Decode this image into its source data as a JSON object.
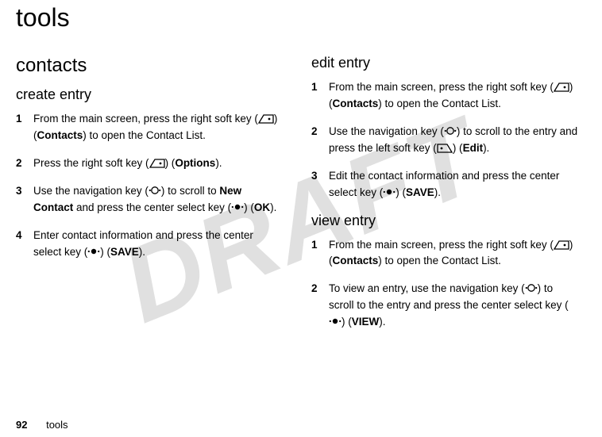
{
  "watermark": "DRAFT",
  "page_title": "tools",
  "left": {
    "section": "contacts",
    "subsection": "create entry",
    "steps": [
      {
        "num": "1",
        "parts": [
          "From the main screen, press the right soft key (",
          {
            "icon": "softkey-right"
          },
          ") (",
          {
            "b": "Contacts"
          },
          ") to open the Contact List."
        ]
      },
      {
        "num": "2",
        "parts": [
          "Press the right soft key (",
          {
            "icon": "softkey-right"
          },
          ") (",
          {
            "b": "Options"
          },
          ")."
        ]
      },
      {
        "num": "3",
        "parts": [
          "Use the navigation key (",
          {
            "icon": "nav"
          },
          ") to scroll to ",
          {
            "b": "New Contact"
          },
          " and press the center select key (",
          {
            "icon": "center"
          },
          ") (",
          {
            "b": "OK"
          },
          ")."
        ]
      },
      {
        "num": "4",
        "parts": [
          "Enter contact information and press the center select key (",
          {
            "icon": "center"
          },
          ") (",
          {
            "b": "SAVE"
          },
          ")."
        ]
      }
    ]
  },
  "right": {
    "sections": [
      {
        "heading": "edit entry",
        "steps": [
          {
            "num": "1",
            "parts": [
              "From the main screen, press the right soft key (",
              {
                "icon": "softkey-right"
              },
              ") (",
              {
                "b": "Contacts"
              },
              ") to open the Contact List."
            ]
          },
          {
            "num": "2",
            "parts": [
              "Use the navigation key (",
              {
                "icon": "nav"
              },
              ") to scroll to the entry and press the left soft key (",
              {
                "icon": "softkey-left"
              },
              ") (",
              {
                "b": "Edit"
              },
              ")."
            ]
          },
          {
            "num": "3",
            "parts": [
              "Edit the contact information and press the center select key (",
              {
                "icon": "center"
              },
              ") (",
              {
                "b": "SAVE"
              },
              ")."
            ]
          }
        ]
      },
      {
        "heading": "view entry",
        "steps": [
          {
            "num": "1",
            "parts": [
              "From the main screen, press the right soft key (",
              {
                "icon": "softkey-right"
              },
              ") (",
              {
                "b": "Contacts"
              },
              ") to open the Contact List."
            ]
          },
          {
            "num": "2",
            "parts": [
              "To view an entry, use the navigation key (",
              {
                "icon": "nav"
              },
              ") to scroll to the entry and press the center select key (",
              {
                "icon": "center"
              },
              ") (",
              {
                "b": "VIEW"
              },
              ")."
            ]
          }
        ]
      }
    ]
  },
  "footer": {
    "page_number": "92",
    "label": "tools"
  }
}
